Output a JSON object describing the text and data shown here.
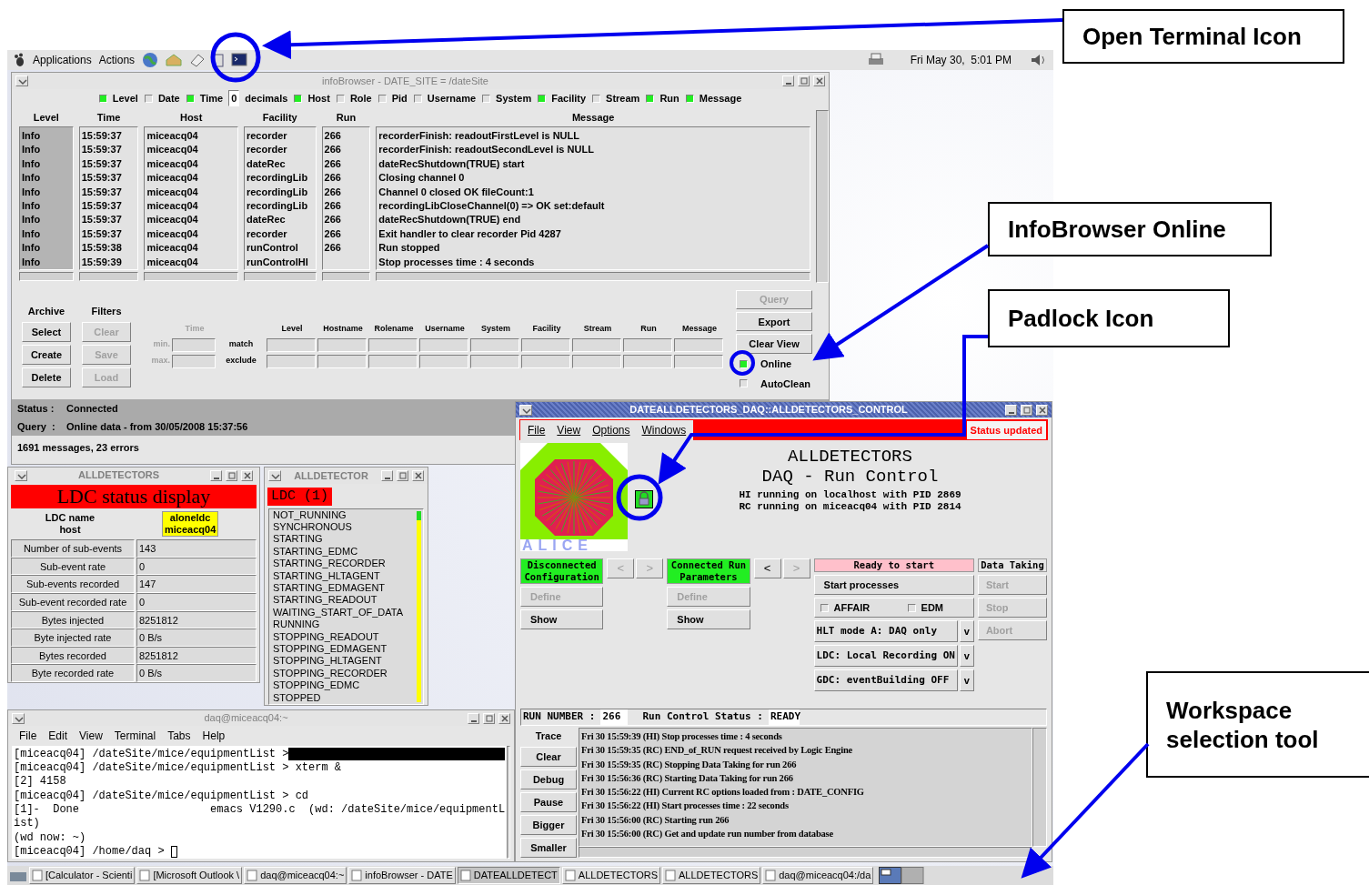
{
  "top_panel": {
    "menus": [
      "Applications",
      "Actions"
    ],
    "clock": "Fri May 30,  5:01 PM"
  },
  "info_browser": {
    "title": "infoBrowser - DATE_SITE = /dateSite",
    "active": false,
    "fields": [
      {
        "label": "Level",
        "checked": true
      },
      {
        "label": "Date",
        "checked": false
      },
      {
        "label": "Time",
        "checked": true,
        "decimals": {
          "value": "0",
          "label": "decimals"
        }
      },
      {
        "label": "Host",
        "checked": true
      },
      {
        "label": "Role",
        "checked": false
      },
      {
        "label": "Pid",
        "checked": false
      },
      {
        "label": "Username",
        "checked": false
      },
      {
        "label": "System",
        "checked": false
      },
      {
        "label": "Facility",
        "checked": true
      },
      {
        "label": "Stream",
        "checked": false
      },
      {
        "label": "Run",
        "checked": true
      },
      {
        "label": "Message",
        "checked": true
      }
    ],
    "columns": [
      "Level",
      "Time",
      "Host",
      "Facility",
      "Run",
      "Message"
    ],
    "rows": [
      [
        "Info",
        "15:59:37",
        "miceacq04",
        "recorder",
        "266",
        "recorderFinish: readoutFirstLevel is NULL"
      ],
      [
        "Info",
        "15:59:37",
        "miceacq04",
        "recorder",
        "266",
        "recorderFinish: readoutSecondLevel is NULL"
      ],
      [
        "Info",
        "15:59:37",
        "miceacq04",
        "dateRec",
        "266",
        "dateRecShutdown(TRUE) start"
      ],
      [
        "Info",
        "15:59:37",
        "miceacq04",
        "recordingLib",
        "266",
        "Closing channel 0"
      ],
      [
        "Info",
        "15:59:37",
        "miceacq04",
        "recordingLib",
        "266",
        "Channel 0 closed OK fileCount:1"
      ],
      [
        "Info",
        "15:59:37",
        "miceacq04",
        "recordingLib",
        "266",
        "recordingLibCloseChannel(0) => OK set:default"
      ],
      [
        "Info",
        "15:59:37",
        "miceacq04",
        "dateRec",
        "266",
        "dateRecShutdown(TRUE) end"
      ],
      [
        "Info",
        "15:59:37",
        "miceacq04",
        "recorder",
        "266",
        "Exit handler to clear recorder Pid 4287"
      ],
      [
        "Info",
        "15:59:38",
        "miceacq04",
        "runControl",
        "266",
        "Run stopped"
      ],
      [
        "Info",
        "15:59:39",
        "miceacq04",
        "runControlHI",
        null,
        "Stop processes time : 4 seconds"
      ]
    ],
    "archive": {
      "title": "Archive",
      "buttons": [
        {
          "label": "Select",
          "disabled": false
        },
        {
          "label": "Create",
          "disabled": false
        },
        {
          "label": "Delete",
          "disabled": false
        }
      ]
    },
    "filters": {
      "title": "Filters",
      "buttons": [
        {
          "label": "Clear",
          "disabled": true
        },
        {
          "label": "Save",
          "disabled": true
        },
        {
          "label": "Load",
          "disabled": true
        }
      ]
    },
    "time_filter": {
      "label": "Time",
      "min": "min.",
      "max": "max."
    },
    "match_label": "match",
    "exclude_label": "exclude",
    "filter_columns": [
      "Level",
      "Hostname",
      "Rolename",
      "Username",
      "System",
      "Facility",
      "Stream",
      "Run",
      "Message"
    ],
    "actions": [
      {
        "label": "Query",
        "disabled": true
      },
      {
        "label": "Export",
        "disabled": false
      },
      {
        "label": "Clear View",
        "disabled": false
      }
    ],
    "options": [
      {
        "label": "Online",
        "checked": true
      },
      {
        "label": "AutoClean",
        "checked": false
      }
    ],
    "status": [
      {
        "label": "Status :",
        "value": "Connected"
      },
      {
        "label": "Query  :",
        "value": "Online data - from 30/05/2008 15:37:56"
      }
    ],
    "summary": "1691 messages, 23 errors"
  },
  "ldc_status": {
    "title": "ALLDETECTORS",
    "active": false,
    "banner": "LDC status display",
    "name_labels": [
      "LDC name",
      "host"
    ],
    "name_values": [
      "aloneldc",
      "miceacq04"
    ],
    "stats": [
      {
        "label": "Number of sub-events",
        "value": "143"
      },
      {
        "label": "Sub-event rate",
        "value": "0"
      },
      {
        "label": "Sub-events recorded",
        "value": "147"
      },
      {
        "label": "Sub-event recorded rate",
        "value": "0"
      },
      {
        "label": "Bytes injected",
        "value": "8251812"
      },
      {
        "label": "Byte injected rate",
        "value": "0 B/s"
      },
      {
        "label": "Bytes recorded",
        "value": "8251812"
      },
      {
        "label": "Byte recorded rate",
        "value": "0 B/s"
      }
    ]
  },
  "ldc_states": {
    "title": "ALLDETECTOR",
    "active": false,
    "banner": "LDC (1)",
    "states": [
      "NOT_RUNNING",
      "SYNCHRONOUS",
      "STARTING",
      "STARTING_EDMC",
      "STARTING_RECORDER",
      "STARTING_HLTAGENT",
      "STARTING_EDMAGENT",
      "STARTING_READOUT",
      "WAITING_START_OF_DATA",
      "RUNNING",
      "STOPPING_READOUT",
      "STOPPING_EDMAGENT",
      "STOPPING_HLTAGENT",
      "STOPPING_RECORDER",
      "STOPPING_EDMC",
      "STOPPED"
    ]
  },
  "terminal": {
    "title": "daq@miceacq04:~",
    "active": false,
    "menus": [
      "File",
      "Edit",
      "View",
      "Terminal",
      "Tabs",
      "Help"
    ],
    "lines": [
      {
        "text": "[miceacq04] /dateSite/mice/equipmentList >",
        "kind": "selection"
      },
      {
        "text": "[miceacq04] /dateSite/mice/equipmentList > xterm &",
        "kind": "plain"
      },
      {
        "text": "[2] 4158",
        "kind": "plain"
      },
      {
        "text": "[miceacq04] /dateSite/mice/equipmentList > cd",
        "kind": "plain"
      },
      {
        "text": "[1]-  Done                    emacs V1290.c  (wd: /dateSite/mice/equipmentL",
        "kind": "plain"
      },
      {
        "text": "ist)",
        "kind": "plain"
      },
      {
        "text": "(wd now: ~)",
        "kind": "plain"
      },
      {
        "text": "[miceacq04] /home/daq > ",
        "kind": "cursor"
      }
    ]
  },
  "run_control": {
    "title": "DATEALLDETECTORS_DAQ::ALLDETECTORS_CONTROL",
    "active": true,
    "menus": [
      "File",
      "View",
      "Options",
      "Windows"
    ],
    "status_badge": "Status updated",
    "logo_text": "ALICE",
    "locked": true,
    "heading": [
      "ALLDETECTORS",
      "DAQ - Run Control"
    ],
    "info": [
      "HI running on localhost with PID 2869",
      "RC running on miceacq04 with PID 2814"
    ],
    "configuration": {
      "state": "Disconnected Configuration",
      "buttons": [
        {
          "label": "Define",
          "disabled": true
        },
        {
          "label": "Show",
          "disabled": false
        }
      ]
    },
    "arrows_1": [
      {
        "label": "<",
        "disabled": true
      },
      {
        "label": ">",
        "disabled": true
      }
    ],
    "parameters": {
      "state": "Connected Run Parameters",
      "buttons": [
        {
          "label": "Define",
          "disabled": true
        },
        {
          "label": "Show",
          "disabled": false
        }
      ]
    },
    "arrows_2": [
      {
        "label": "<",
        "disabled": false
      },
      {
        "label": ">",
        "disabled": true
      }
    ],
    "process": {
      "state": "Ready to start",
      "button": "Start processes",
      "checks": [
        {
          "label": "AFFAIR",
          "checked": false
        },
        {
          "label": "EDM",
          "checked": false
        }
      ],
      "selects": [
        {
          "value": "HLT mode A: DAQ only",
          "arrow": "v"
        },
        {
          "value": "LDC: Local Recording ON",
          "arrow": "v"
        },
        {
          "value": "GDC: eventBuilding OFF",
          "arrow": "v"
        }
      ]
    },
    "data_taking": {
      "title": "Data Taking",
      "buttons": [
        {
          "label": "Start",
          "disabled": true
        },
        {
          "label": "Stop",
          "disabled": true
        },
        {
          "label": "Abort",
          "disabled": true
        }
      ]
    },
    "run_number_label": "RUN NUMBER :",
    "run_number": "266",
    "status_label": "Run Control Status :",
    "status": "READY",
    "trace_label": "Trace",
    "log_buttons": [
      "Clear",
      "Debug",
      "Pause",
      "Bigger",
      "Smaller"
    ],
    "log": [
      "Fri 30 15:59:39 (HI) Stop processes time : 4 seconds",
      "Fri 30 15:59:35 (RC) END_of_RUN request received by Logic Engine",
      "Fri 30 15:59:35 (RC) Stopping Data Taking for run 266",
      "Fri 30 15:56:36 (RC) Starting Data Taking for run 266",
      "Fri 30 15:56:22 (HI) Current RC options loaded from : DATE_CONFIG",
      "Fri 30 15:56:22 (HI) Start processes time : 22 seconds",
      "Fri 30 15:56:00 (RC) Starting run 266",
      "Fri 30 15:56:00 (RC) Get and update run number from database"
    ]
  },
  "taskbar": [
    {
      "label": "[Calculator - Scienti",
      "selected": false
    },
    {
      "label": "[Microsoft Outlook \\",
      "selected": false
    },
    {
      "label": "daq@miceacq04:~",
      "selected": false
    },
    {
      "label": "infoBrowser - DATE",
      "selected": false
    },
    {
      "label": "DATEALLDETECT",
      "selected": true
    },
    {
      "label": "ALLDETECTORS",
      "selected": false
    },
    {
      "label": "ALLDETECTORS",
      "selected": false
    },
    {
      "label": "daq@miceacq04:/da",
      "selected": false
    }
  ],
  "callouts": [
    "Open Terminal Icon",
    "InfoBrowser Online",
    "Padlock Icon",
    "Workspace selection tool"
  ]
}
